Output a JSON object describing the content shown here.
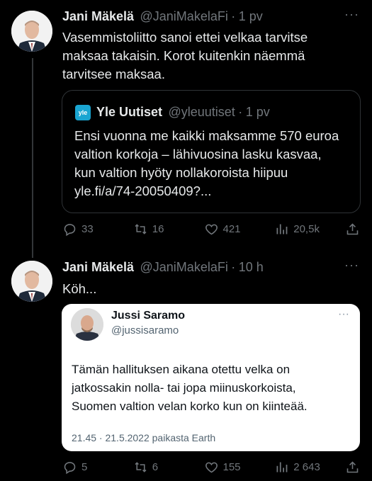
{
  "tweet1": {
    "name": "Jani Mäkelä",
    "handle": "@JaniMakelaFi",
    "separator": "·",
    "time": "1 pv",
    "more": "···",
    "text": "Vasemmistoliitto sanoi ettei velkaa tarvitse maksaa takaisin. Korot kuitenkin näemmä tarvitsee maksaa.",
    "quote": {
      "logo": "yle",
      "name": "Yle Uutiset",
      "handle": "@yleuutiset",
      "separator": "·",
      "time": "1 pv",
      "text": "Ensi vuonna me kaikki maksamme 570 euroa valtion korkoja – lähivuosina lasku kasvaa, kun valtion hyöty nollakoroista hiipuu yle.fi/a/74-20050409?..."
    },
    "actions": {
      "replies": "33",
      "retweets": "16",
      "likes": "421",
      "views": "20,5k"
    }
  },
  "tweet2": {
    "name": "Jani Mäkelä",
    "handle": "@JaniMakelaFi",
    "separator": "·",
    "time": "10 h",
    "more": "···",
    "text": "Köh...",
    "embedded": {
      "name": "Jussi Saramo",
      "handle": "@jussisaramo",
      "more": "···",
      "text": "Tämän hallituksen aikana otettu velka on jatkossakin nolla- tai jopa miinuskorkoista, Suomen valtion velan korko kun on kiinteää.",
      "meta": "21.45 · 21.5.2022 paikasta Earth"
    },
    "actions": {
      "replies": "5",
      "retweets": "6",
      "likes": "155",
      "views": "2 643"
    }
  },
  "colors": {
    "background": "#000000",
    "text": "#e7e9ea",
    "muted": "#71767b",
    "border": "#2f3336",
    "yle": "#1aa5d1"
  }
}
